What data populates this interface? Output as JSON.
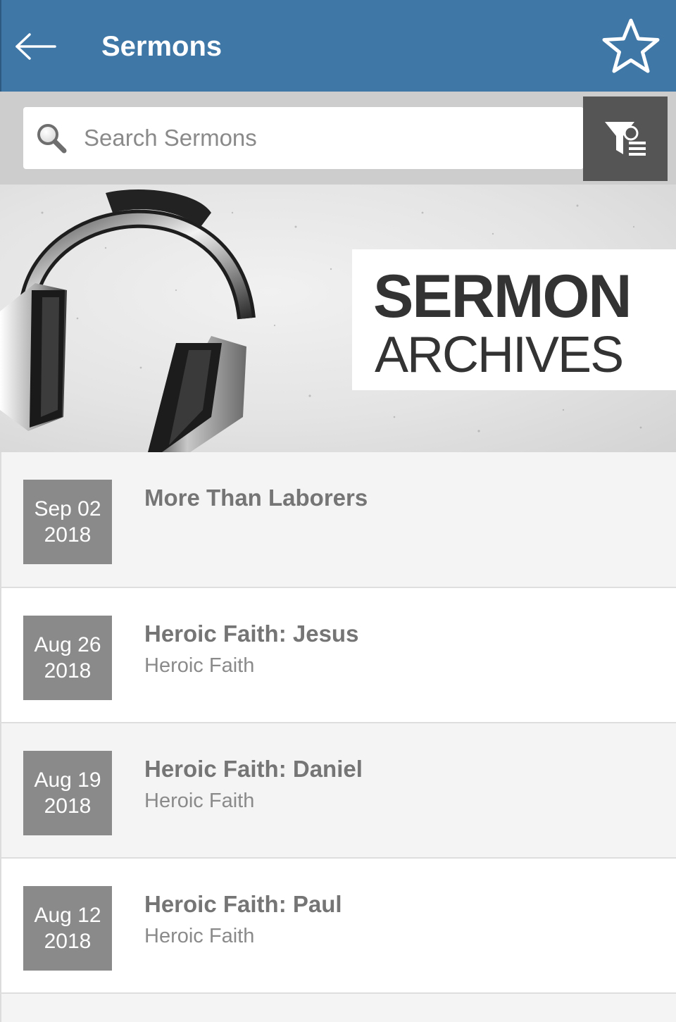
{
  "header": {
    "title": "Sermons",
    "background_color": "#3f77a6"
  },
  "search": {
    "placeholder": "Search Sermons",
    "value": ""
  },
  "banner": {
    "line1": "SERMON",
    "line2": "ARCHIVES"
  },
  "sermons": [
    {
      "month_day": "Sep 02",
      "year": "2018",
      "title": "More Than Laborers",
      "series": ""
    },
    {
      "month_day": "Aug 26",
      "year": "2018",
      "title": "Heroic Faith: Jesus",
      "series": "Heroic Faith"
    },
    {
      "month_day": "Aug 19",
      "year": "2018",
      "title": "Heroic Faith: Daniel",
      "series": "Heroic Faith"
    },
    {
      "month_day": "Aug 12",
      "year": "2018",
      "title": "Heroic Faith: Paul",
      "series": "Heroic Faith"
    }
  ],
  "icons": {
    "back": "arrow-left-icon",
    "favorite": "star-outline-icon",
    "search": "magnifier-icon",
    "filter": "filter-list-icon",
    "banner_art": "headphones-image"
  },
  "colors": {
    "date_badge": "#8a8a8a",
    "filter_button": "#555555",
    "search_strip": "#cdcdcd"
  }
}
